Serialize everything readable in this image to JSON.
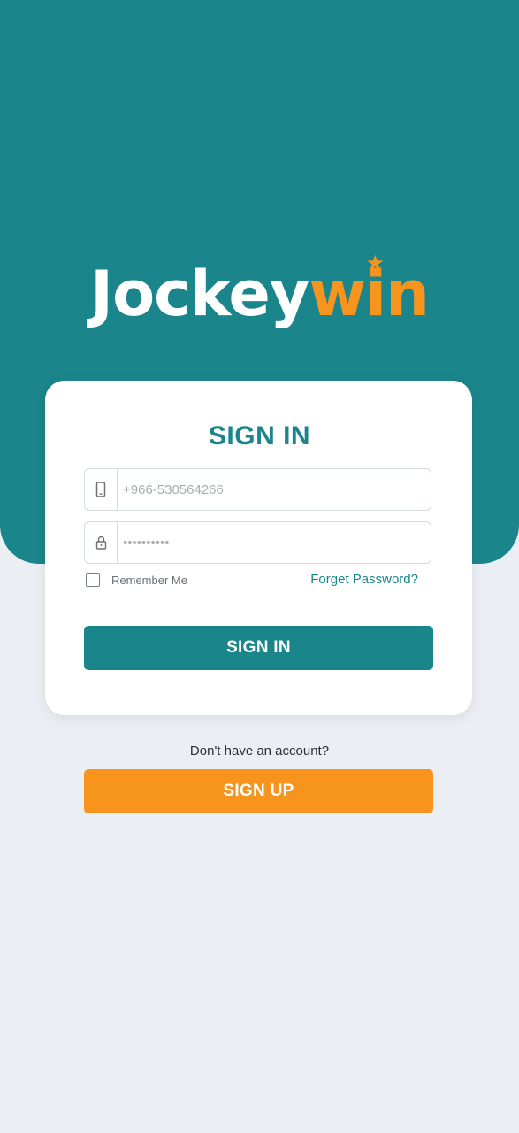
{
  "brand": {
    "part1": "Jockey",
    "part2": "win",
    "star_glyph": "★"
  },
  "colors": {
    "primary": "#1B858C",
    "accent": "#F7941D",
    "background": "#EBEEF3",
    "card": "#FFFFFF"
  },
  "signin": {
    "title": "SIGN IN",
    "phone_placeholder": "+966-530564266",
    "password_placeholder": "••••••••••",
    "remember_label": "Remember Me",
    "remember_checked": false,
    "forgot_label": "Forget Password?",
    "submit_label": "SIGN IN"
  },
  "signup": {
    "prompt": "Don't have an account?",
    "button_label": "SIGN UP"
  },
  "icons": {
    "phone": "mobile-phone-icon",
    "password": "lock-icon"
  }
}
